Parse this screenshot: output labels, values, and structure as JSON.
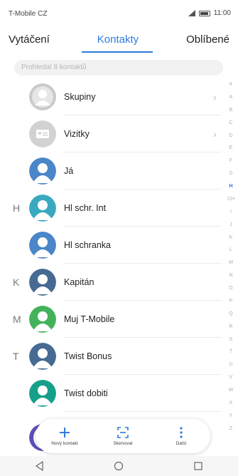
{
  "status_bar": {
    "carrier": "T-Mobile CZ",
    "time": "11:00"
  },
  "tabs": [
    {
      "label": "Vytáčení"
    },
    {
      "label": "Kontakty",
      "active": true
    },
    {
      "label": "Oblíbené"
    }
  ],
  "search": {
    "placeholder": "Prohledat 8 kontaktů"
  },
  "contacts": [
    {
      "letter": "",
      "name": "Skupiny",
      "avatar": "group",
      "chevron": "›"
    },
    {
      "letter": "",
      "name": "Vizitky",
      "avatar": "card",
      "chevron": "›"
    },
    {
      "letter": "",
      "name": "Já",
      "avatar": "blue"
    },
    {
      "letter": "H",
      "name": "Hl schr. Int",
      "avatar": "teal"
    },
    {
      "letter": "",
      "name": "Hl schranka",
      "avatar": "blue"
    },
    {
      "letter": "K",
      "name": "Kapitán",
      "avatar": "navy"
    },
    {
      "letter": "M",
      "name": "Muj T-Mobile",
      "avatar": "green"
    },
    {
      "letter": "T",
      "name": "Twist Bonus",
      "avatar": "navy"
    },
    {
      "letter": "",
      "name": "Twist dobiti",
      "avatar": "dteal"
    }
  ],
  "index_letters": [
    "#",
    "A",
    "B",
    "C",
    "D",
    "E",
    "F",
    "G",
    "H",
    "CH",
    "I",
    "J",
    "K",
    "L",
    "M",
    "N",
    "O",
    "P",
    "Q",
    "R",
    "S",
    "T",
    "U",
    "V",
    "W",
    "X",
    "Y",
    "Z"
  ],
  "index_active": "H",
  "actions": [
    {
      "label": "Nový kontakt",
      "icon": "plus-icon"
    },
    {
      "label": "Skenovat",
      "icon": "scan-icon"
    },
    {
      "label": "Další",
      "icon": "more-icon"
    }
  ],
  "colors": {
    "accent": "#2f7bdb",
    "avatar_blue": "#4a86c8",
    "avatar_teal": "#3aa9c0",
    "avatar_navy": "#466a92",
    "avatar_green": "#43b25a",
    "avatar_dteal": "#169f8a",
    "avatar_grey": "#c9c9c9",
    "avatar_purple": "#5a4fb8"
  }
}
